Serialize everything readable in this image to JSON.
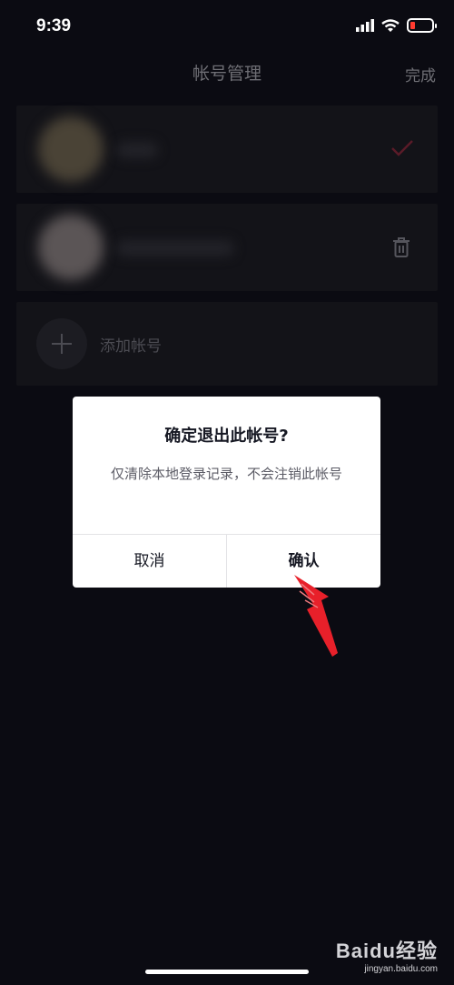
{
  "status_bar": {
    "time": "9:39"
  },
  "nav": {
    "title": "帐号管理",
    "done_label": "完成"
  },
  "accounts": {
    "add_label": "添加帐号"
  },
  "dialog": {
    "title": "确定退出此帐号?",
    "message": "仅清除本地登录记录，不会注销此帐号",
    "cancel_label": "取消",
    "confirm_label": "确认"
  },
  "watermark": {
    "main": "Baidu经验",
    "sub": "jingyan.baidu.com"
  },
  "colors": {
    "accent": "#fe2c55",
    "annotation_arrow": "#e8202a",
    "background": "#0b0b12"
  }
}
